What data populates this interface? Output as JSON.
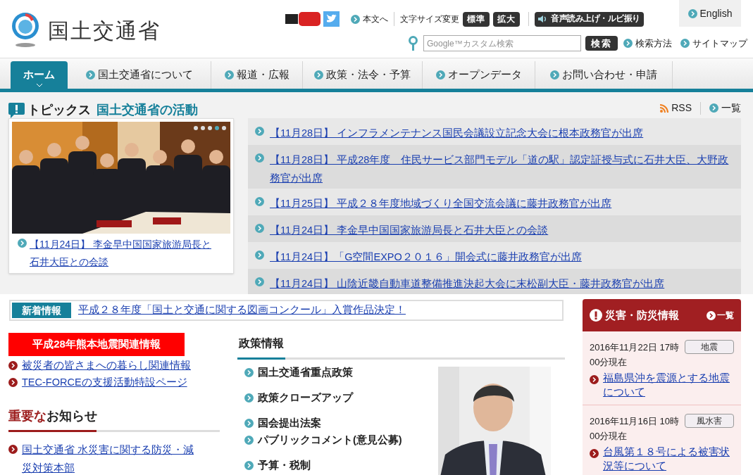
{
  "header": {
    "site_name": "国土交通省",
    "skip_link": "本文へ",
    "font_size_label": "文字サイズ変更",
    "font_size_buttons": [
      "標準",
      "拡大"
    ],
    "speech_button": "音声読み上げ・ルビ振り",
    "english_link": "English",
    "search": {
      "placeholder": "Google™カスタム検索",
      "button": "検索"
    },
    "search_help": "検索方法",
    "sitemap": "サイトマップ"
  },
  "nav": [
    {
      "label": "ホーム",
      "selected": true
    },
    {
      "label": "国土交通省について",
      "selected": false
    },
    {
      "label": "報道・広報",
      "selected": false
    },
    {
      "label": "政策・法令・予算",
      "selected": false
    },
    {
      "label": "オープンデータ",
      "selected": false
    },
    {
      "label": "お問い合わせ・申請",
      "selected": false
    }
  ],
  "topics": {
    "title": "トピックス",
    "subtitle": "国土交通省の活動",
    "rss": "RSS",
    "list_link": "一覧",
    "slideshow": {
      "dots": [
        {
          "selected": false
        },
        {
          "selected": false
        },
        {
          "selected": false
        },
        {
          "selected": true
        },
        {
          "selected": false
        }
      ],
      "caption": "【11月24日】 李金早中国国家旅游局長と石井大臣との会談"
    },
    "items": [
      "【11月28日】 インフラメンテナンス国民会議設立記念大会に根本政務官が出席",
      "【11月28日】 平成28年度　住民サービス部門モデル「道の駅」認定証授与式に石井大臣、大野政務官が出席",
      "【11月25日】 平成２８年度地域づくり全国交流会議に藤井政務官が出席",
      "【11月24日】 李金早中国国家旅游局長と石井大臣との会談",
      "【11月24日】「G空間EXPO２０１６」開会式に藤井政務官が出席",
      "【11月24日】 山陰近畿自動車道整備推進決起大会に末松副大臣・藤井政務官が出席"
    ]
  },
  "news": {
    "label": "新着情報",
    "text": "平成２８年度「国土と交通に関する図画コンクール」入賞作品決定！"
  },
  "kumamoto": {
    "banner": "平成28年熊本地震関連情報",
    "links": [
      "被災者の皆さまへの暮らし関連情報",
      "TEC-FORCEの支援活動特設ページ"
    ]
  },
  "notices": {
    "title": "重要な**お知らせ**",
    "links": [
      "国土交通省 水災害に関する防災・減災対策本部"
    ]
  },
  "policy": {
    "title": "政策情報",
    "items": [
      "国土交通省重点政策",
      "政策クローズアップ",
      "国会提出法案",
      "パブリックコメント(意見公募)",
      "予算・税制"
    ]
  },
  "disaster": {
    "title": "災害・防災情報",
    "list_link": "一覧",
    "items": [
      {
        "time": "2016年11月22日 17時00分現在",
        "tag": "地震",
        "link": "福島県沖を震源とする地震について"
      },
      {
        "time": "2016年11月16日 10時00分現在",
        "tag": "風水害",
        "link": "台風第１８号による被害状況等について"
      }
    ]
  }
}
